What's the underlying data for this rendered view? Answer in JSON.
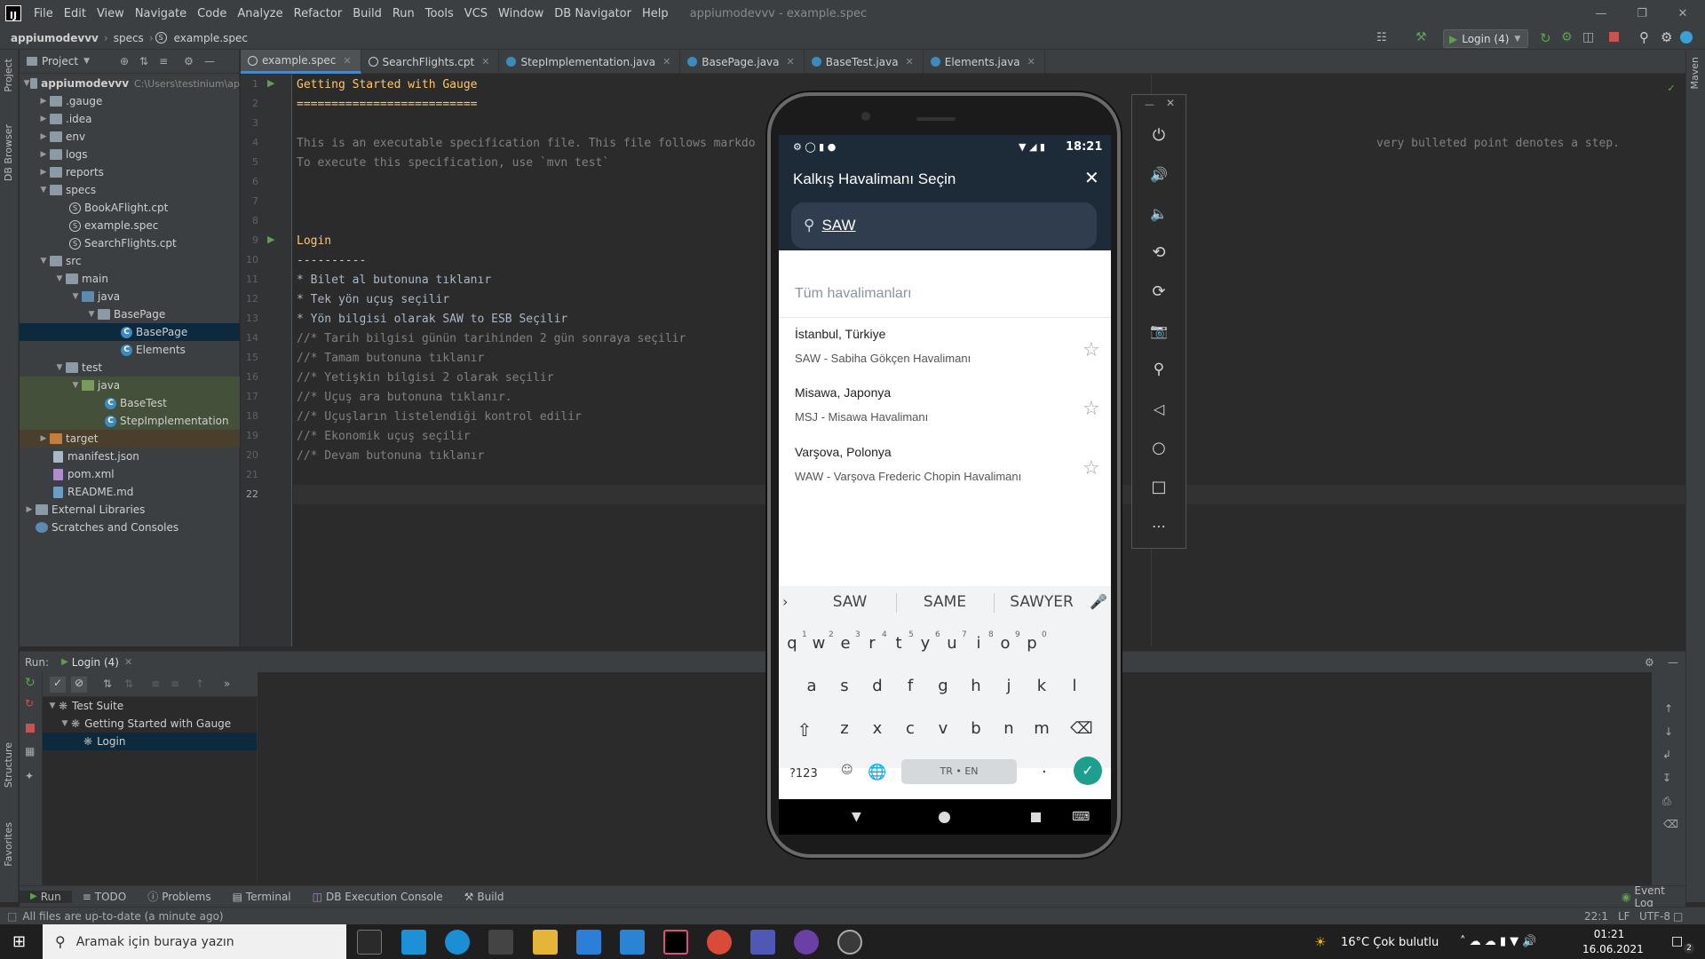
{
  "menubar": {
    "items": [
      "File",
      "Edit",
      "View",
      "Navigate",
      "Code",
      "Analyze",
      "Refactor",
      "Build",
      "Run",
      "Tools",
      "VCS",
      "Window",
      "DB Navigator",
      "Help"
    ],
    "window_title": "appiumodevvv - example.spec"
  },
  "navbar": {
    "crumbs": [
      "appiumodevvv",
      "specs",
      "example.spec"
    ],
    "run_config": "Login (4)"
  },
  "project": {
    "header": "Project",
    "root_label": "appiumodevvv",
    "root_path": "C:\\Users\\testinium\\ap",
    "items": [
      ".gauge",
      ".idea",
      "env",
      "logs",
      "reports",
      "specs",
      "BookAFlight.cpt",
      "example.spec",
      "SearchFlights.cpt",
      "src",
      "main",
      "java",
      "BasePage",
      "BasePage",
      "Elements",
      "test",
      "java",
      "BaseTest",
      "StepImplementation",
      "target",
      "manifest.json",
      "pom.xml",
      "README.md",
      "External Libraries",
      "Scratches and Consoles"
    ]
  },
  "tabs": [
    "example.spec",
    "SearchFlights.cpt",
    "StepImplementation.java",
    "BasePage.java",
    "BaseTest.java",
    "Elements.java"
  ],
  "editor": {
    "lines": [
      {
        "n": "1",
        "t": "Getting Started with Gauge",
        "c": "gold"
      },
      {
        "n": "2",
        "t": "==========================",
        "c": "gold"
      },
      {
        "n": "3",
        "t": "",
        "c": ""
      },
      {
        "n": "4",
        "t": "This is an executable specification file. This file follows markdo",
        "c": "gray"
      },
      {
        "n": "5",
        "t": "To execute this specification, use `mvn test`",
        "c": "gray"
      },
      {
        "n": "6",
        "t": "",
        "c": ""
      },
      {
        "n": "7",
        "t": "",
        "c": ""
      },
      {
        "n": "8",
        "t": "",
        "c": ""
      },
      {
        "n": "9",
        "t": "Login",
        "c": "gold"
      },
      {
        "n": "10",
        "t": "----------",
        "c": "gold"
      },
      {
        "n": "11",
        "t": "* Bilet al butonuna tıklanır",
        "c": ""
      },
      {
        "n": "12",
        "t": "* Tek yön uçuş seçilir",
        "c": ""
      },
      {
        "n": "13",
        "t": "* Yön bilgisi olarak SAW to ESB Seçilir",
        "c": ""
      },
      {
        "n": "14",
        "t": "//* Tarih bilgisi günün tarihinden 2 gün sonraya seçilir",
        "c": "gray"
      },
      {
        "n": "15",
        "t": "//* Tamam butonuna tıklanır",
        "c": "gray"
      },
      {
        "n": "16",
        "t": "//* Yetişkin bilgisi 2 olarak seçilir",
        "c": "gray"
      },
      {
        "n": "17",
        "t": "//* Uçuş ara butonuna tıklanır.",
        "c": "gray"
      },
      {
        "n": "18",
        "t": "//* Uçuşların listelendiği kontrol edilir",
        "c": "gray"
      },
      {
        "n": "19",
        "t": "//* Ekonomik uçuş seçilir",
        "c": "gray"
      },
      {
        "n": "20",
        "t": "//* Devam butonuna tıklanır",
        "c": "gray"
      },
      {
        "n": "21",
        "t": "",
        "c": ""
      },
      {
        "n": "22",
        "t": "",
        "c": ""
      }
    ],
    "overflow_text": "very bulleted point denotes a step."
  },
  "run": {
    "label": "Run:",
    "config": "Login (4)",
    "tree": [
      "Test Suite",
      "Getting Started with Gauge",
      "Login"
    ]
  },
  "toolwindows": [
    "Run",
    "TODO",
    "Problems",
    "Terminal",
    "DB Execution Console",
    "Build"
  ],
  "event_log": "Event Log",
  "status": {
    "message": "All files are up-to-date (a minute ago)",
    "position": "22:1",
    "line_sep": "LF",
    "encoding": "UTF-8"
  },
  "side_labels": {
    "project": "Project",
    "db_browser": "DB Browser",
    "structure": "Structure",
    "favorites": "Favorites",
    "maven": "Maven"
  },
  "phone": {
    "time": "18:21",
    "title": "Kalkış Havalimanı Seçin",
    "search_value": "SAW",
    "all_airports": "Tüm havalimanları",
    "results": [
      {
        "city": "İstanbul, Türkiye",
        "airport": "SAW - Sabiha Gökçen Havalimanı"
      },
      {
        "city": "Misawa, Japonya",
        "airport": "MSJ - Misawa Havalimanı"
      },
      {
        "city": "Varşova, Polonya",
        "airport": "WAW - Varşova Frederic Chopin Havalimanı"
      }
    ],
    "suggestions": [
      "SAW",
      "SAME",
      "SAWYER"
    ],
    "row1": [
      "q",
      "w",
      "e",
      "r",
      "t",
      "y",
      "u",
      "i",
      "o",
      "p"
    ],
    "row1_nums": [
      "1",
      "2",
      "3",
      "4",
      "5",
      "6",
      "7",
      "8",
      "9",
      "0"
    ],
    "row2": [
      "a",
      "s",
      "d",
      "f",
      "g",
      "h",
      "j",
      "k",
      "l"
    ],
    "row3": [
      "z",
      "x",
      "c",
      "v",
      "b",
      "n",
      "m"
    ],
    "sym_key": "?123",
    "space_label": "TR • EN",
    "period": "."
  },
  "taskbar": {
    "search_placeholder": "Aramak için buraya yazın",
    "weather": "16°C  Çok bulutlu",
    "time": "01:21",
    "date": "16.06.2021",
    "notif_count": "2"
  }
}
